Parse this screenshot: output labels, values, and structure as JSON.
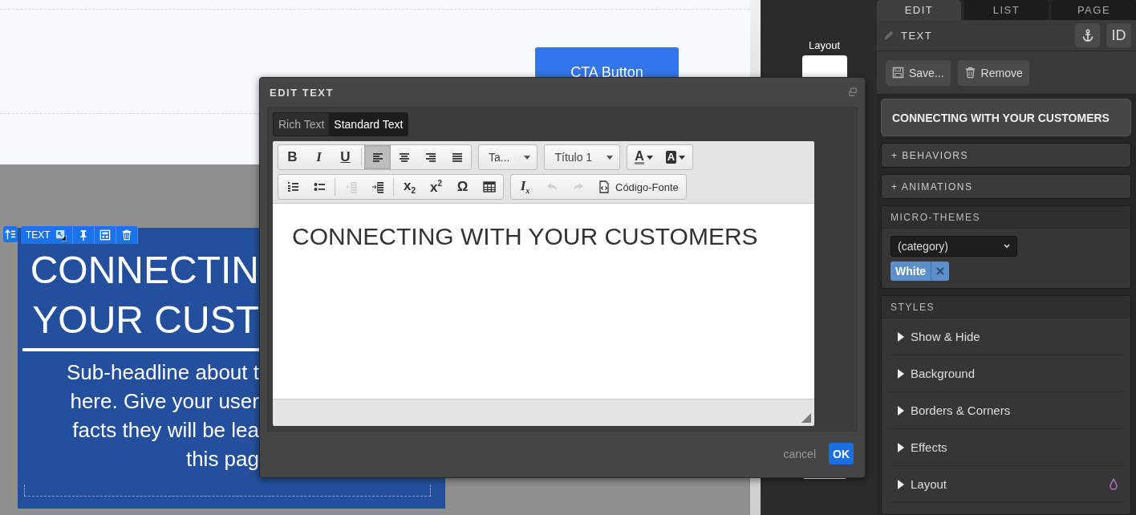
{
  "canvas": {
    "cta_button": "CTA Button",
    "element_toolbar": {
      "label": "TEXT"
    },
    "headline_lines": [
      "CONNECTIN",
      "YOUR CUST"
    ],
    "subheadline_lines": [
      "Sub-headline about t",
      "here. Give your user",
      "facts they will be lea",
      "this pag"
    ]
  },
  "widget_strip": {
    "label": "Layout"
  },
  "dialog": {
    "title": "EDIT TEXT",
    "tabs": [
      {
        "label": "Rich Text",
        "selected": false
      },
      {
        "label": "Standard Text",
        "selected": true
      }
    ],
    "toolbar": [
      [
        {
          "kind": "buttons",
          "buttons": [
            {
              "kind": "glyph",
              "label": "B",
              "active": false,
              "disabled": false
            },
            {
              "kind": "glyph",
              "label": "I",
              "active": false,
              "disabled": false
            },
            {
              "kind": "glyph",
              "label": "U",
              "active": false,
              "disabled": false
            },
            {
              "kind": "separator"
            },
            {
              "kind": "alignleft",
              "active": true,
              "disabled": false
            },
            {
              "kind": "aligncenter",
              "active": false,
              "disabled": false
            },
            {
              "kind": "alignright",
              "active": false,
              "disabled": false
            },
            {
              "kind": "justify",
              "active": false,
              "disabled": false
            }
          ]
        },
        {
          "kind": "dropdown",
          "value": "Ta..."
        },
        {
          "kind": "dropdown",
          "value": "Título 1"
        },
        {
          "kind": "buttons",
          "buttons": [
            {
              "kind": "textcolor",
              "label": "A",
              "active": false,
              "disabled": false
            },
            {
              "kind": "bgcolor",
              "label": "A",
              "active": false,
              "disabled": false
            }
          ]
        }
      ],
      [
        {
          "kind": "buttons",
          "buttons": [
            {
              "kind": "numbered",
              "active": false,
              "disabled": false
            },
            {
              "kind": "bulleted",
              "active": false,
              "disabled": false
            },
            {
              "kind": "separator"
            },
            {
              "kind": "outdent",
              "active": false,
              "disabled": true
            },
            {
              "kind": "indent",
              "active": false,
              "disabled": false
            },
            {
              "kind": "separator"
            },
            {
              "kind": "glyph",
              "label": "x$_{2}$",
              "active": false,
              "disabled": false
            },
            {
              "kind": "glyph",
              "label": "x$^{2}$",
              "active": false,
              "disabled": false
            },
            {
              "kind": "glyph",
              "label": "Ω",
              "active": false,
              "disabled": false
            },
            {
              "kind": "table",
              "active": false,
              "disabled": false
            }
          ]
        },
        {
          "kind": "buttons",
          "buttons": [
            {
              "kind": "glyph",
              "label": "I$_{x}$",
              "active": false,
              "disabled": false
            },
            {
              "kind": "undo",
              "active": false,
              "disabled": true
            },
            {
              "kind": "redo",
              "active": false,
              "disabled": true
            },
            {
              "kind": "source",
              "label": "Código-Fonte",
              "active": false,
              "disabled": false
            }
          ]
        }
      ]
    ],
    "content": "CONNECTING WITH YOUR CUSTOMERS",
    "cancel": "cancel",
    "ok": "OK"
  },
  "panel": {
    "tabs": [
      {
        "label": "EDIT",
        "selected": true
      },
      {
        "label": "LIST",
        "selected": false
      },
      {
        "label": "PAGE",
        "selected": false
      }
    ],
    "header": {
      "title": "TEXT",
      "id_button": "ID"
    },
    "actions": [
      "Save...",
      "Remove"
    ],
    "element_name": "CONNECTING WITH YOUR CUSTOMERS",
    "behaviors": "+ BEHAVIORS",
    "animations": "+ ANIMATIONS",
    "micro_themes": {
      "title": "MICRO-THEMES",
      "select": "(category)",
      "tags": [
        {
          "label": "White"
        }
      ]
    },
    "styles": {
      "title": "STYLES",
      "items": [
        {
          "label": "Show & Hide",
          "expanded": false,
          "themed": false
        },
        {
          "label": "Background",
          "expanded": false,
          "themed": false
        },
        {
          "label": "Borders & Corners",
          "expanded": false,
          "themed": false
        },
        {
          "label": "Effects",
          "expanded": false,
          "themed": false
        },
        {
          "label": "Layout",
          "expanded": false,
          "themed": true
        }
      ]
    }
  }
}
